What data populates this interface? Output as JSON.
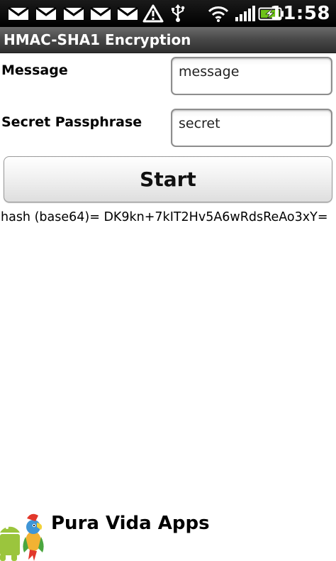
{
  "status_bar": {
    "time": "11:58",
    "icons": [
      "gmail-icon",
      "gmail-icon",
      "gmail-icon",
      "gmail-icon",
      "gmail-icon",
      "warning-icon",
      "usb-icon",
      "wifi-icon",
      "signal-icon",
      "battery-charging-icon"
    ]
  },
  "titlebar": {
    "title": "HMAC-SHA1 Encryption"
  },
  "form": {
    "message_label": "Message",
    "message_value": "message",
    "passphrase_label": "Secret Passphrase",
    "passphrase_value": "secret",
    "start_label": "Start"
  },
  "result": {
    "hash_text": "hash (base64)= DK9kn+7kIT2Hv5A6wRdsReAo3xY="
  },
  "footer": {
    "brand": "Pura Vida Apps",
    "logo_icon": "android-parrot-logo-icon"
  },
  "colors": {
    "status_bar_bg": "#000000",
    "titlebar_bg": "#4a4a4a",
    "page_bg": "#ffffff",
    "battery_charge": "#6fc21b"
  }
}
